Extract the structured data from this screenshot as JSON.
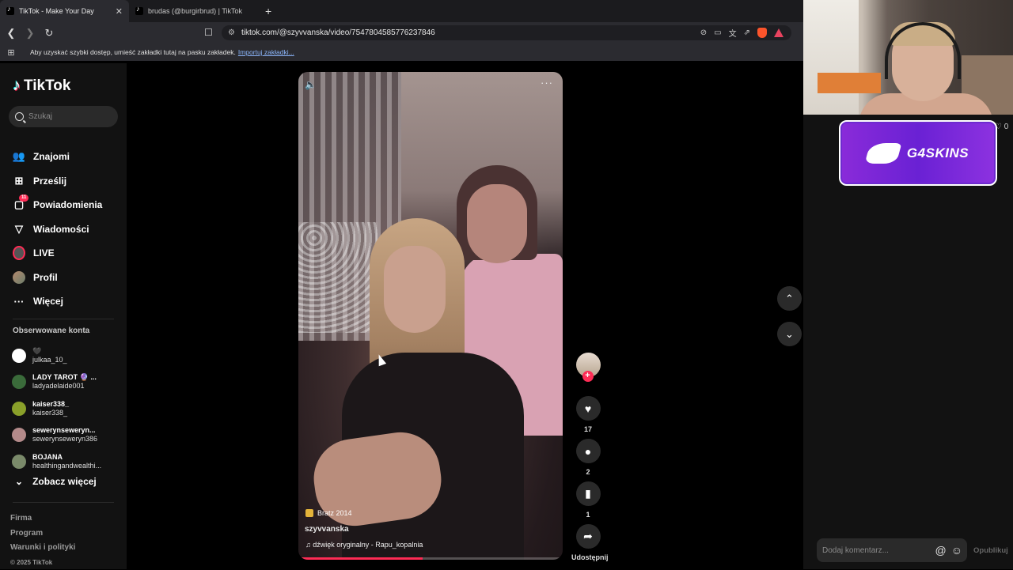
{
  "browser": {
    "tabs": [
      {
        "title": "TikTok - Make Your Day",
        "close": "✕"
      },
      {
        "title": "brudas (@burgirbrud) | TikTok"
      }
    ],
    "new_tab": "+",
    "url": "tiktok.com/@szyvvanska/video/7547804585776237846",
    "bookmarks_msg": "Aby uzyskać szybki dostęp, umieść zakładki tutaj na pasku zakładek.",
    "bookmarks_link": "Importuj zakładki..."
  },
  "sidebar": {
    "logo": "TikTok",
    "search_placeholder": "Szukaj",
    "items": [
      {
        "label": "Znajomi",
        "icon": "friends-icon"
      },
      {
        "label": "Prześlij",
        "icon": "upload-icon"
      },
      {
        "label": "Powiadomienia",
        "icon": "notifications-icon",
        "badge": "11"
      },
      {
        "label": "Wiadomości",
        "icon": "messages-icon"
      },
      {
        "label": "LIVE",
        "icon": "live-icon"
      },
      {
        "label": "Profil",
        "icon": "profile-icon"
      },
      {
        "label": "Więcej",
        "icon": "more-icon"
      }
    ],
    "followed_title": "Obserwowane konta",
    "followed": [
      {
        "name": "🖤",
        "handle": "julkaa_10_",
        "color": "#ffffff"
      },
      {
        "name": "LADY TAROT 🔮 ...",
        "handle": "ladyadelaide001",
        "color": "#3a6b3a"
      },
      {
        "name": "kaiser338_",
        "handle": "kaiser338_",
        "color": "#8aa02a"
      },
      {
        "name": "sewerynseweryn...",
        "handle": "sewerynseweryn386",
        "color": "#b38a8a"
      },
      {
        "name": "BOJANA",
        "handle": "healthingandwealthi...",
        "color": "#7a8a6a"
      }
    ],
    "see_more": "Zobacz więcej",
    "footer": [
      "Firma",
      "Program",
      "Warunki i polityki"
    ],
    "copyright": "© 2025 TikTok"
  },
  "video": {
    "tag": "Bratz 2014",
    "user": "szyvvanska",
    "music": "♫ dźwięk oryginalny - Rapu_kopalnia",
    "progress_fraction": 0.47
  },
  "actions": {
    "likes": "17",
    "comments": "2",
    "saves": "1",
    "share": "Udostępnij"
  },
  "right": {
    "heart_count": "♡ 0",
    "sponsor": "G4SKINS",
    "comment_placeholder": "Dodaj komentarz...",
    "publish": "Opublikuj"
  },
  "colors": {
    "accent": "#fe2c55",
    "sponsor": "#7a28d8"
  }
}
